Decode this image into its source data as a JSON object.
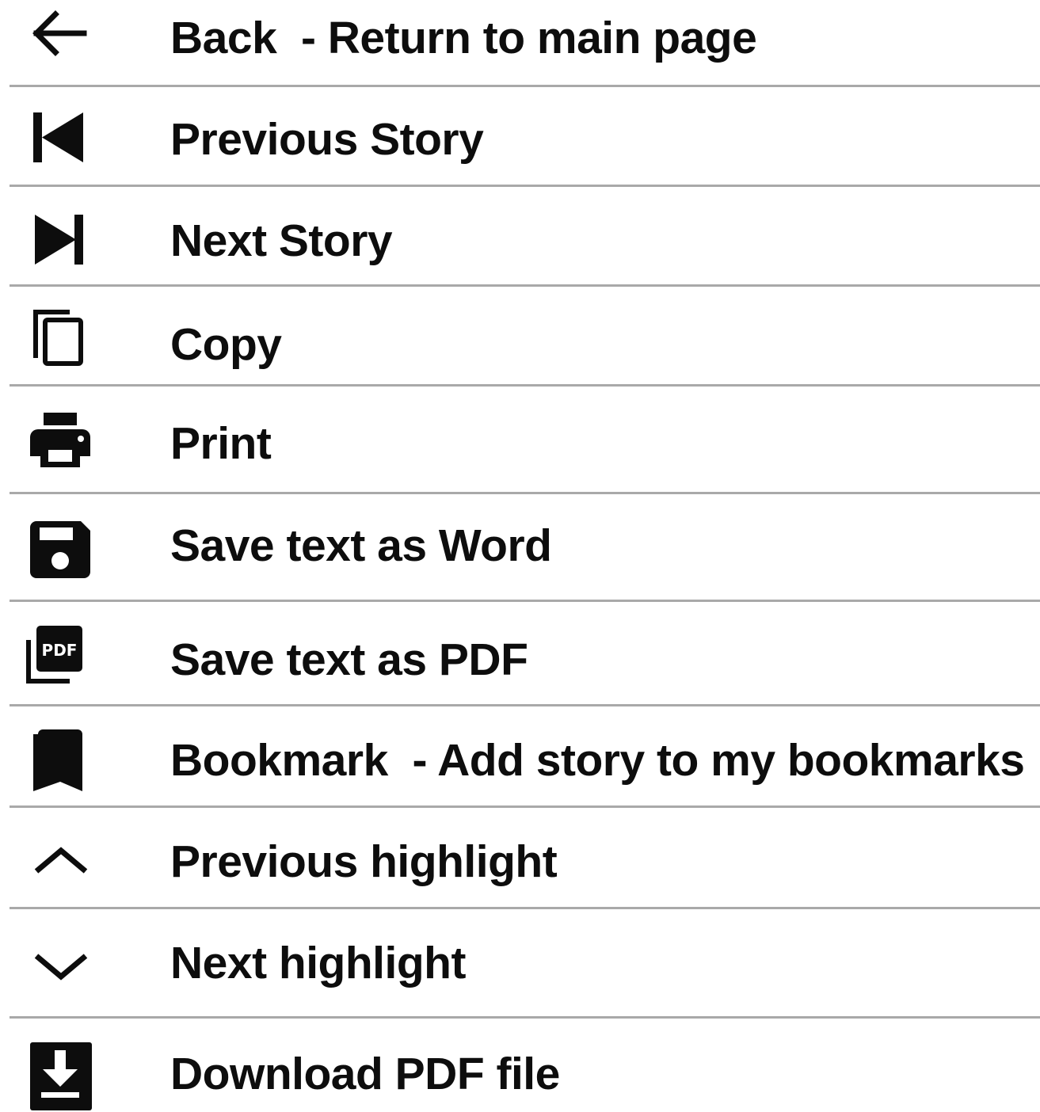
{
  "menu": {
    "items": [
      {
        "icon": "arrow-left-icon",
        "label": "Back  - Return to main page"
      },
      {
        "icon": "skip-previous-icon",
        "label": "Previous Story"
      },
      {
        "icon": "skip-next-icon",
        "label": "Next Story"
      },
      {
        "icon": "copy-icon",
        "label": "Copy"
      },
      {
        "icon": "printer-icon",
        "label": "Print"
      },
      {
        "icon": "floppy-disk-icon",
        "label": "Save text as Word"
      },
      {
        "icon": "pdf-file-icon",
        "label": "Save text as PDF"
      },
      {
        "icon": "bookmark-icon",
        "label": "Bookmark  - Add story to my bookmarks"
      },
      {
        "icon": "chevron-up-icon",
        "label": "Previous highlight"
      },
      {
        "icon": "chevron-down-icon",
        "label": "Next highlight"
      },
      {
        "icon": "download-icon",
        "label": "Download PDF file"
      }
    ]
  }
}
